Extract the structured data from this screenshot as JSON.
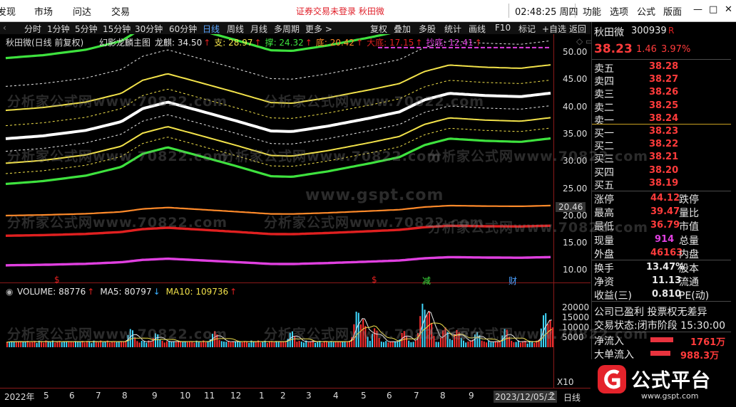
{
  "menubar": {
    "items": [
      "发现",
      "市场",
      "问达",
      "交易"
    ],
    "notice": "证券交易未登录  秋田微",
    "clock": "02:48:25 周四",
    "right_items": [
      "功能",
      "选项",
      "公式",
      "版面"
    ],
    "window_controls": [
      "—",
      "□",
      "✕"
    ]
  },
  "periodbar": {
    "items": [
      "分时",
      "1分钟",
      "5分钟",
      "15分钟",
      "30分钟",
      "60分钟",
      "日线",
      "周线",
      "月线",
      "多周期",
      "更多 >"
    ],
    "active": "日线",
    "tools": [
      "复权",
      "叠加",
      "多股",
      "统计",
      "画线",
      "F10",
      "标记",
      "+自选",
      "返回"
    ]
  },
  "main_chart": {
    "title": "秋田微(日线 前复权)",
    "indicator": "幻影龙麟主图",
    "legend": [
      {
        "label": "龙麒: 34.50",
        "arrow": "↑",
        "color": "#e8e8e8"
      },
      {
        "label": "支: 28.97",
        "arrow": "↑",
        "color": "#f2e24a"
      },
      {
        "label": "撑: 24.32",
        "arrow": "↑",
        "color": "#3ee23e"
      },
      {
        "label": "底: 20.42",
        "arrow": "↑",
        "color": "#ff8a2a"
      },
      {
        "label": "大底: 17.15",
        "arrow": "↑",
        "color": "#e02020"
      },
      {
        "label": "抄底: 12.41",
        "arrow": "↑",
        "color": "#e040e0"
      }
    ],
    "y_ticks": [
      "50.00",
      "45.00",
      "40.00",
      "35.00",
      "30.00",
      "25.00",
      "20.00",
      "15.00",
      "10.00"
    ],
    "price_marker": "20.46",
    "signals": [
      {
        "text": "$",
        "color": "#e02020"
      },
      {
        "text": "$",
        "color": "#e02020"
      },
      {
        "text": "减",
        "color": "#3ee23e"
      },
      {
        "text": "财",
        "color": "#4aa0ff"
      }
    ]
  },
  "volume_chart": {
    "legend": [
      {
        "label": "VOLUME: 88776",
        "arrow": "↑",
        "color": "#e8e8e8"
      },
      {
        "label": "MA5: 80797",
        "arrow": "↓",
        "color": "#e8e8e8"
      },
      {
        "label": "MA10: 109736",
        "arrow": "↑",
        "color": "#f2e24a"
      }
    ],
    "y_ticks": [
      "20000",
      "15000",
      "10000",
      "5000"
    ],
    "unit": "X10"
  },
  "date_axis": {
    "labels": [
      "2022年",
      "5",
      "6",
      "7",
      "8",
      "9",
      "10",
      "11",
      "12",
      "1",
      "2",
      "3",
      "4",
      "5",
      "6",
      "7",
      "8",
      "9",
      "2023/12/05/二",
      "2"
    ],
    "period": "日线"
  },
  "quote_panel": {
    "name": "秋田微",
    "code": "300939",
    "tag": "R",
    "price": "38.23",
    "change": "1.46",
    "change_pct": "3.97%",
    "asks": [
      {
        "label": "卖五",
        "price": "38.28"
      },
      {
        "label": "卖四",
        "price": "38.27"
      },
      {
        "label": "卖三",
        "price": "38.26"
      },
      {
        "label": "卖二",
        "price": "38.25"
      },
      {
        "label": "卖一",
        "price": "38.24"
      }
    ],
    "bids": [
      {
        "label": "买一",
        "price": "38.23"
      },
      {
        "label": "买二",
        "price": "38.22"
      },
      {
        "label": "买三",
        "price": "38.21"
      },
      {
        "label": "买四",
        "price": "38.20"
      },
      {
        "label": "买五",
        "price": "38.19"
      }
    ],
    "stats": [
      {
        "label": "涨停",
        "value": "44.12",
        "label2": "跌停",
        "color": "#ff3b3b"
      },
      {
        "label": "最高",
        "value": "39.47",
        "label2": "量比",
        "color": "#ff3b3b"
      },
      {
        "label": "最低",
        "value": "36.79",
        "label2": "市值",
        "color": "#ff3b3b"
      },
      {
        "label": "现量",
        "value": "914",
        "label2": "总量",
        "color": "#e040e0"
      },
      {
        "label": "外盘",
        "value": "46163",
        "label2": "内盘",
        "color": "#ff3b3b"
      }
    ],
    "stats2": [
      {
        "label": "换手",
        "value": "13.47%",
        "label2": "股本"
      },
      {
        "label": "净资",
        "value": "11.13",
        "label2": "流通"
      },
      {
        "label": "收益(三)",
        "value": "0.810",
        "label2": "PE(动)"
      }
    ],
    "profit_note": "公司已盈利 投票权无差异",
    "trade_status": "交易状态:闭市阶段 15:30:00",
    "flows": [
      {
        "label": "净流入",
        "value": "1761万"
      },
      {
        "label": "大单流入",
        "value": "988.3万"
      }
    ]
  },
  "logo": {
    "text": "公式平台",
    "sub": "www.gspt.com"
  },
  "watermarks": [
    "分析家公式网www.70822.com",
    "www.gspt.com"
  ]
}
